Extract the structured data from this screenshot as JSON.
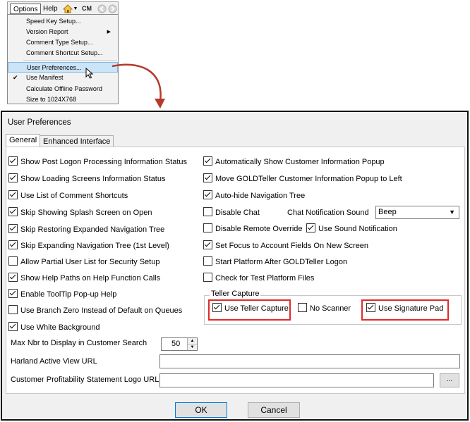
{
  "menubar": {
    "options": "Options",
    "help": "Help"
  },
  "toolbar": {
    "icons": [
      "home-icon",
      "dropdown-arrow-icon",
      "cm-logo-icon",
      "back-icon",
      "forward-icon"
    ],
    "cm_label": "CM"
  },
  "options_menu": {
    "items": [
      {
        "label": "Speed Key Setup...",
        "submenu": false,
        "checked": false,
        "highlighted": false
      },
      {
        "label": "Version Report",
        "submenu": true,
        "checked": false,
        "highlighted": false
      },
      {
        "label": "Comment Type Setup...",
        "submenu": false,
        "checked": false,
        "highlighted": false
      },
      {
        "label": "Comment Shortcut Setup...",
        "submenu": false,
        "checked": false,
        "highlighted": false
      },
      {
        "label": "User Preferences...",
        "submenu": false,
        "checked": false,
        "highlighted": true
      },
      {
        "label": "Use Manifest",
        "submenu": false,
        "checked": true,
        "highlighted": false
      },
      {
        "label": "Calculate Offline Password",
        "submenu": false,
        "checked": false,
        "highlighted": false
      },
      {
        "label": "Size to 1024X768",
        "submenu": false,
        "checked": false,
        "highlighted": false
      }
    ]
  },
  "dialog": {
    "title": "User Preferences",
    "tabs": [
      "General",
      "Enhanced Interface"
    ],
    "active_tab": "General",
    "left_checkboxes": [
      {
        "label": "Show Post Logon Processing Information Status",
        "checked": true
      },
      {
        "label": "Show Loading Screens Information Status",
        "checked": true
      },
      {
        "label": "Use List of Comment Shortcuts",
        "checked": true
      },
      {
        "label": "Skip Showing Splash Screen on Open",
        "checked": true
      },
      {
        "label": "Skip Restoring Expanded Navigation Tree",
        "checked": true
      },
      {
        "label": "Skip Expanding Navigation Tree (1st Level)",
        "checked": true
      },
      {
        "label": "Allow Partial User List for Security Setup",
        "checked": false
      },
      {
        "label": "Show Help Paths on Help Function Calls",
        "checked": true
      },
      {
        "label": "Enable ToolTip Pop-up Help",
        "checked": true
      },
      {
        "label": "Use Branch Zero Instead of Default on Queues",
        "checked": false
      },
      {
        "label": "Use White Background",
        "checked": true
      }
    ],
    "right_checkboxes": [
      {
        "label": "Automatically Show Customer Information Popup",
        "checked": true
      },
      {
        "label": "Move GOLDTeller Customer Information Popup to Left",
        "checked": true
      },
      {
        "label": "Auto-hide Navigation Tree",
        "checked": true
      },
      {
        "label": "Disable Chat",
        "checked": false
      },
      {
        "label": "Disable Remote Override",
        "checked": false
      },
      {
        "label": "Set Focus to Account Fields On New Screen",
        "checked": true
      },
      {
        "label": "Start Platform After GOLDTeller Logon",
        "checked": false
      },
      {
        "label": "Check for Test Platform Files",
        "checked": false
      }
    ],
    "use_sound_notification": {
      "label": "Use Sound Notification",
      "checked": true
    },
    "chat_sound": {
      "label": "Chat Notification Sound",
      "value": "Beep"
    },
    "teller_capture": {
      "legend": "Teller Capture",
      "use_teller_capture": {
        "label": "Use Teller Capture",
        "checked": true
      },
      "no_scanner": {
        "label": "No Scanner",
        "checked": false
      },
      "use_signature_pad": {
        "label": "Use Signature Pad",
        "checked": true
      },
      "highlight_color": "#e02a2a"
    },
    "max_nbr": {
      "label": "Max Nbr to Display in Customer Search",
      "value": "50"
    },
    "harland_url": {
      "label": "Harland Active View URL",
      "value": ""
    },
    "logo_url": {
      "label": "Customer Profitability Statement Logo URL",
      "value": ""
    },
    "browse_label": "...",
    "ok_label": "OK",
    "cancel_label": "Cancel"
  },
  "colors": {
    "accent": "#0078d7",
    "arrow": "#b5392c",
    "menu_highlight": "#cce4f7"
  }
}
